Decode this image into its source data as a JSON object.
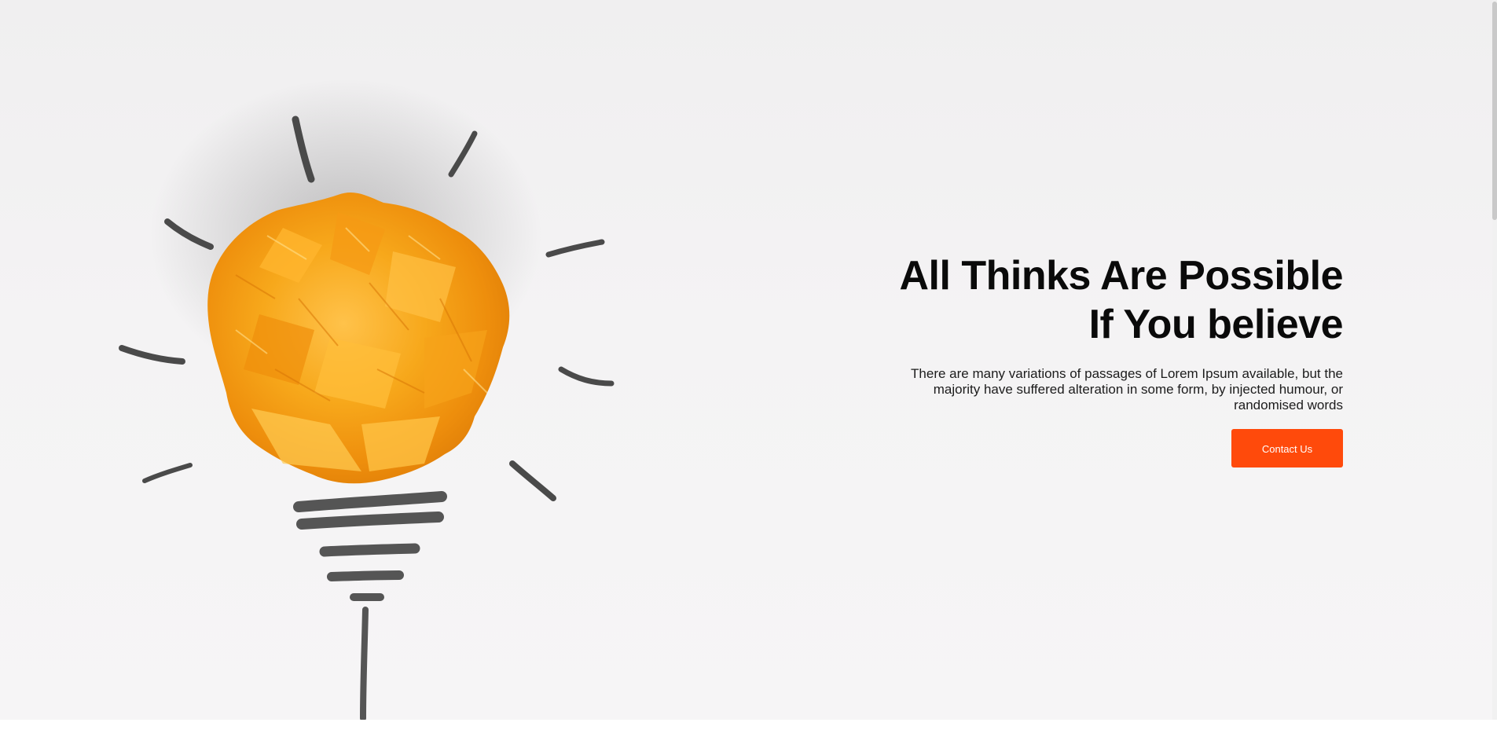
{
  "hero": {
    "title_line1": "All Thinks Are Possible",
    "title_line2": "If You believe",
    "description": "There are many variations of passages of Lorem Ipsum available, but the majority have suffered alteration in some form, by injected humour, or randomised words",
    "cta_label": "Contact Us",
    "image_icon": "crumpled-paper-lightbulb-illustration"
  },
  "colors": {
    "accent": "#ff4a0b",
    "title": "#0a0a0a",
    "background": "#f2f1f2",
    "bulb": "#f7a81b",
    "sketch": "#4a4a4a"
  }
}
